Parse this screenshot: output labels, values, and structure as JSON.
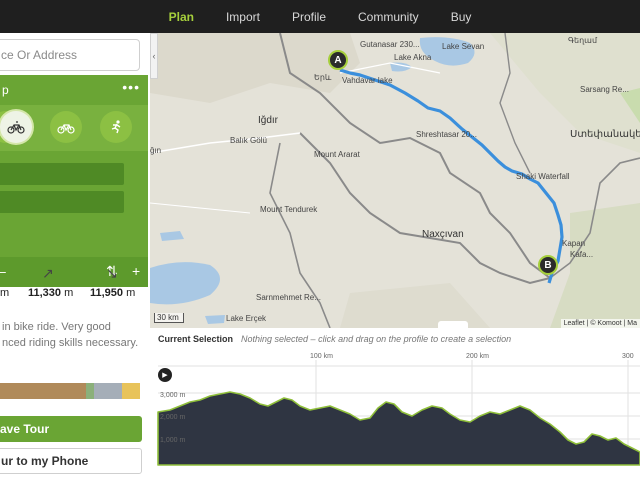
{
  "nav": {
    "items": [
      {
        "label": "Plan",
        "active": true
      },
      {
        "label": "Import",
        "active": false
      },
      {
        "label": "Profile",
        "active": false
      },
      {
        "label": "Community",
        "active": false
      },
      {
        "label": "Buy",
        "active": false
      }
    ]
  },
  "search": {
    "placeholder": "ce Or Address"
  },
  "planner": {
    "label": "p",
    "more": "•••",
    "sports": [
      {
        "icon": "hiking-icon",
        "selected": false
      },
      {
        "icon": "mountain-bike-icon",
        "selected": true
      },
      {
        "icon": "bike-icon",
        "selected": false
      },
      {
        "icon": "running-icon",
        "selected": false
      }
    ],
    "footer_minus": "–",
    "footer_sort": "⇅",
    "footer_plus": "+"
  },
  "stats": {
    "distance_unit": "m",
    "uphill": "11,330",
    "uphill_unit": "m",
    "downhill": "11,950",
    "downhill_unit": "m",
    "up_arrow": "↗",
    "down_arrow": "↘"
  },
  "description": {
    "line1": "in bike ride. Very good",
    "line2": "nced riding skills necessary."
  },
  "surface_colors": [
    "#b08a5a",
    "#8bb07a",
    "#a5aeb8",
    "#e8c35a"
  ],
  "buttons": {
    "save": "ave Tour",
    "phone": "ur to my Phone"
  },
  "map": {
    "labels": [
      {
        "text": "Gutanasar 230...",
        "cls": ""
      },
      {
        "text": "Lake Sevan",
        "cls": ""
      },
      {
        "text": "Lake Akna",
        "cls": ""
      },
      {
        "text": "Vahdavar lake",
        "cls": ""
      },
      {
        "text": "Երև",
        "cls": ""
      },
      {
        "text": "Iğdır",
        "cls": "big"
      },
      {
        "text": "Balık Gölü",
        "cls": ""
      },
      {
        "text": "Mount Ararat",
        "cls": ""
      },
      {
        "text": "Mount Tendurek",
        "cls": ""
      },
      {
        "text": "Shreshtasar 20...",
        "cls": ""
      },
      {
        "text": "Shaki Waterfall",
        "cls": ""
      },
      {
        "text": "Naxçıvan",
        "cls": "big"
      },
      {
        "text": "Kapan",
        "cls": ""
      },
      {
        "text": "Sarnmehmet Re...",
        "cls": ""
      },
      {
        "text": "Lake Erçek",
        "cls": ""
      },
      {
        "text": "Sarsang Re...",
        "cls": ""
      },
      {
        "text": "Ստեփանակերտ",
        "cls": "big"
      },
      {
        "text": "Գեղամ",
        "cls": ""
      },
      {
        "text": "Kafa...",
        "cls": ""
      },
      {
        "text": "ğın",
        "cls": ""
      }
    ],
    "scale": "30 km",
    "attribution": "Leaflet | © Komoot | Ma",
    "marker_a": "A",
    "marker_b": "B"
  },
  "profile": {
    "title": "Current Selection",
    "hint": "Nothing selected – click and drag on the profile to create a selection",
    "x_ticks": [
      "100 km",
      "200 km",
      "300"
    ],
    "y_ticks": [
      "3,000 m",
      "2,000 m",
      "1,000 m"
    ]
  }
}
